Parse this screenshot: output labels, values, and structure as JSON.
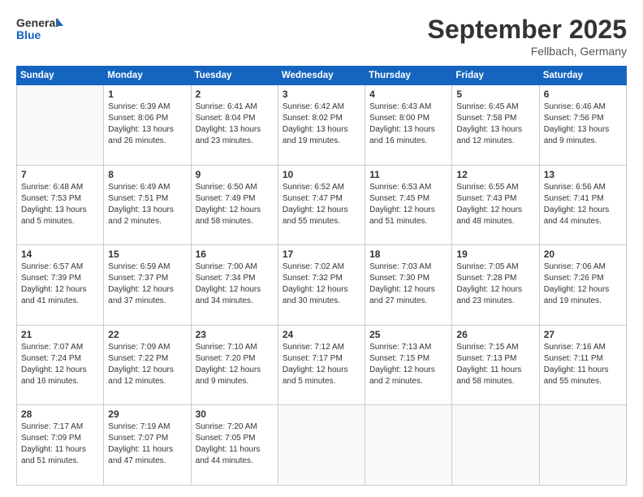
{
  "logo": {
    "line1": "General",
    "line2": "Blue"
  },
  "title": "September 2025",
  "location": "Fellbach, Germany",
  "weekdays": [
    "Sunday",
    "Monday",
    "Tuesday",
    "Wednesday",
    "Thursday",
    "Friday",
    "Saturday"
  ],
  "weeks": [
    [
      {
        "day": "",
        "info": ""
      },
      {
        "day": "1",
        "info": "Sunrise: 6:39 AM\nSunset: 8:06 PM\nDaylight: 13 hours\nand 26 minutes."
      },
      {
        "day": "2",
        "info": "Sunrise: 6:41 AM\nSunset: 8:04 PM\nDaylight: 13 hours\nand 23 minutes."
      },
      {
        "day": "3",
        "info": "Sunrise: 6:42 AM\nSunset: 8:02 PM\nDaylight: 13 hours\nand 19 minutes."
      },
      {
        "day": "4",
        "info": "Sunrise: 6:43 AM\nSunset: 8:00 PM\nDaylight: 13 hours\nand 16 minutes."
      },
      {
        "day": "5",
        "info": "Sunrise: 6:45 AM\nSunset: 7:58 PM\nDaylight: 13 hours\nand 12 minutes."
      },
      {
        "day": "6",
        "info": "Sunrise: 6:46 AM\nSunset: 7:56 PM\nDaylight: 13 hours\nand 9 minutes."
      }
    ],
    [
      {
        "day": "7",
        "info": "Sunrise: 6:48 AM\nSunset: 7:53 PM\nDaylight: 13 hours\nand 5 minutes."
      },
      {
        "day": "8",
        "info": "Sunrise: 6:49 AM\nSunset: 7:51 PM\nDaylight: 13 hours\nand 2 minutes."
      },
      {
        "day": "9",
        "info": "Sunrise: 6:50 AM\nSunset: 7:49 PM\nDaylight: 12 hours\nand 58 minutes."
      },
      {
        "day": "10",
        "info": "Sunrise: 6:52 AM\nSunset: 7:47 PM\nDaylight: 12 hours\nand 55 minutes."
      },
      {
        "day": "11",
        "info": "Sunrise: 6:53 AM\nSunset: 7:45 PM\nDaylight: 12 hours\nand 51 minutes."
      },
      {
        "day": "12",
        "info": "Sunrise: 6:55 AM\nSunset: 7:43 PM\nDaylight: 12 hours\nand 48 minutes."
      },
      {
        "day": "13",
        "info": "Sunrise: 6:56 AM\nSunset: 7:41 PM\nDaylight: 12 hours\nand 44 minutes."
      }
    ],
    [
      {
        "day": "14",
        "info": "Sunrise: 6:57 AM\nSunset: 7:39 PM\nDaylight: 12 hours\nand 41 minutes."
      },
      {
        "day": "15",
        "info": "Sunrise: 6:59 AM\nSunset: 7:37 PM\nDaylight: 12 hours\nand 37 minutes."
      },
      {
        "day": "16",
        "info": "Sunrise: 7:00 AM\nSunset: 7:34 PM\nDaylight: 12 hours\nand 34 minutes."
      },
      {
        "day": "17",
        "info": "Sunrise: 7:02 AM\nSunset: 7:32 PM\nDaylight: 12 hours\nand 30 minutes."
      },
      {
        "day": "18",
        "info": "Sunrise: 7:03 AM\nSunset: 7:30 PM\nDaylight: 12 hours\nand 27 minutes."
      },
      {
        "day": "19",
        "info": "Sunrise: 7:05 AM\nSunset: 7:28 PM\nDaylight: 12 hours\nand 23 minutes."
      },
      {
        "day": "20",
        "info": "Sunrise: 7:06 AM\nSunset: 7:26 PM\nDaylight: 12 hours\nand 19 minutes."
      }
    ],
    [
      {
        "day": "21",
        "info": "Sunrise: 7:07 AM\nSunset: 7:24 PM\nDaylight: 12 hours\nand 16 minutes."
      },
      {
        "day": "22",
        "info": "Sunrise: 7:09 AM\nSunset: 7:22 PM\nDaylight: 12 hours\nand 12 minutes."
      },
      {
        "day": "23",
        "info": "Sunrise: 7:10 AM\nSunset: 7:20 PM\nDaylight: 12 hours\nand 9 minutes."
      },
      {
        "day": "24",
        "info": "Sunrise: 7:12 AM\nSunset: 7:17 PM\nDaylight: 12 hours\nand 5 minutes."
      },
      {
        "day": "25",
        "info": "Sunrise: 7:13 AM\nSunset: 7:15 PM\nDaylight: 12 hours\nand 2 minutes."
      },
      {
        "day": "26",
        "info": "Sunrise: 7:15 AM\nSunset: 7:13 PM\nDaylight: 11 hours\nand 58 minutes."
      },
      {
        "day": "27",
        "info": "Sunrise: 7:16 AM\nSunset: 7:11 PM\nDaylight: 11 hours\nand 55 minutes."
      }
    ],
    [
      {
        "day": "28",
        "info": "Sunrise: 7:17 AM\nSunset: 7:09 PM\nDaylight: 11 hours\nand 51 minutes."
      },
      {
        "day": "29",
        "info": "Sunrise: 7:19 AM\nSunset: 7:07 PM\nDaylight: 11 hours\nand 47 minutes."
      },
      {
        "day": "30",
        "info": "Sunrise: 7:20 AM\nSunset: 7:05 PM\nDaylight: 11 hours\nand 44 minutes."
      },
      {
        "day": "",
        "info": ""
      },
      {
        "day": "",
        "info": ""
      },
      {
        "day": "",
        "info": ""
      },
      {
        "day": "",
        "info": ""
      }
    ]
  ]
}
